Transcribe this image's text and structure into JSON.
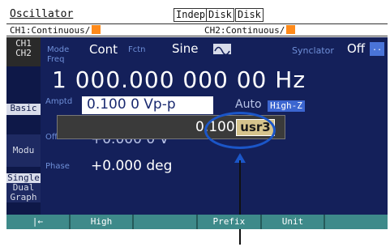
{
  "header": {
    "title": "Oscillator",
    "tabs": [
      "Indep",
      "Disk",
      "Disk"
    ],
    "ch1_status": "CH1:Continuous/",
    "ch2_status": "CH2:Continuous/"
  },
  "sidebar": {
    "channel": "CH1\nCH2",
    "basic": "Basic",
    "modu": "Modu",
    "single": "Single",
    "dual": "Dual",
    "graph": "Graph"
  },
  "params": {
    "mode_label": "Mode",
    "mode_value": "Cont",
    "fctn_label": "Fctn",
    "fctn_value": "Sine",
    "sync_label": "Synclator",
    "sync_value": "Off",
    "sync_btn": "..",
    "freq_label": "Freq",
    "freq_value": "1 000.000 000 00  Hz",
    "amptd_label": "Amptd",
    "amptd_value": "0.100 0  Vp-p",
    "auto_label": "Auto",
    "highz": "High-Z",
    "offset_label": "Offset",
    "offset_value": "+0.000 0  V",
    "phase_label": "Phase",
    "phase_value": "+0.000  deg"
  },
  "popup": {
    "value": "0.100 0",
    "unit": "usr3"
  },
  "softkeys": [
    "|←",
    "High",
    "",
    "Prefix",
    "Unit",
    ""
  ],
  "colors": {
    "background": "#14205a",
    "accent": "#3c66d0",
    "softkey": "#3e8a8a",
    "callout": "#1b56c8"
  }
}
